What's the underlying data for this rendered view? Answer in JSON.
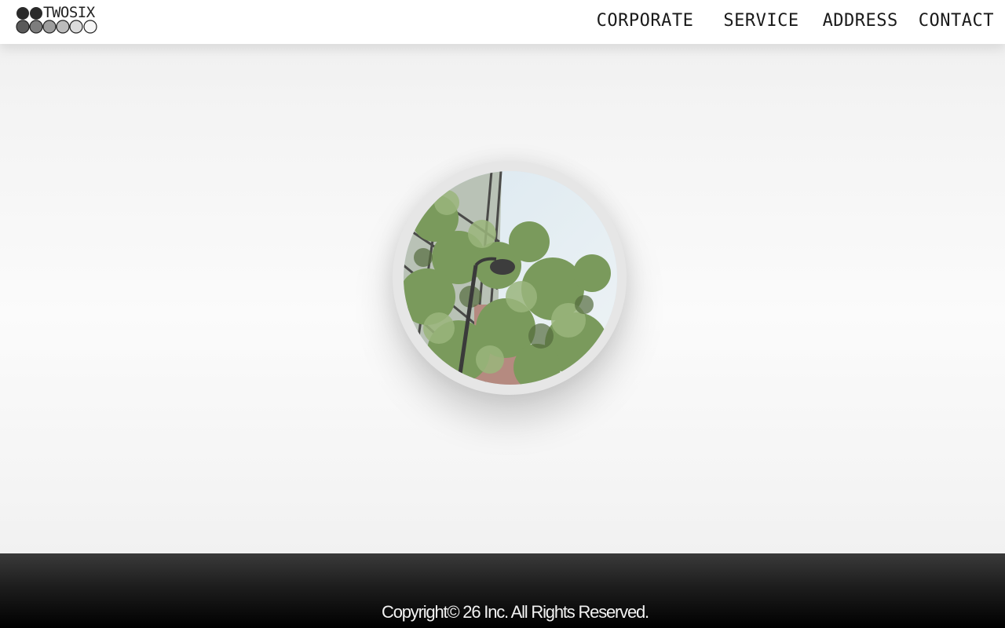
{
  "header": {
    "logo_text": "TWOSIX",
    "logo_icon": "twosix-dots-logo"
  },
  "nav": {
    "items": [
      {
        "label": "CORPORATE"
      },
      {
        "label": "SERVICE"
      },
      {
        "label": "ADDRESS"
      },
      {
        "label": "CONTACT"
      }
    ]
  },
  "hero": {
    "image": "circular-photo-building-trees-streetlight"
  },
  "footer": {
    "copyright": "Copyright© 26 Inc. All Rights Reserved."
  },
  "colors": {
    "header_bg": "#ffffff",
    "nav_text": "#1a1a1a",
    "footer_bg": "#000000",
    "footer_text": "#f2f2f2"
  }
}
